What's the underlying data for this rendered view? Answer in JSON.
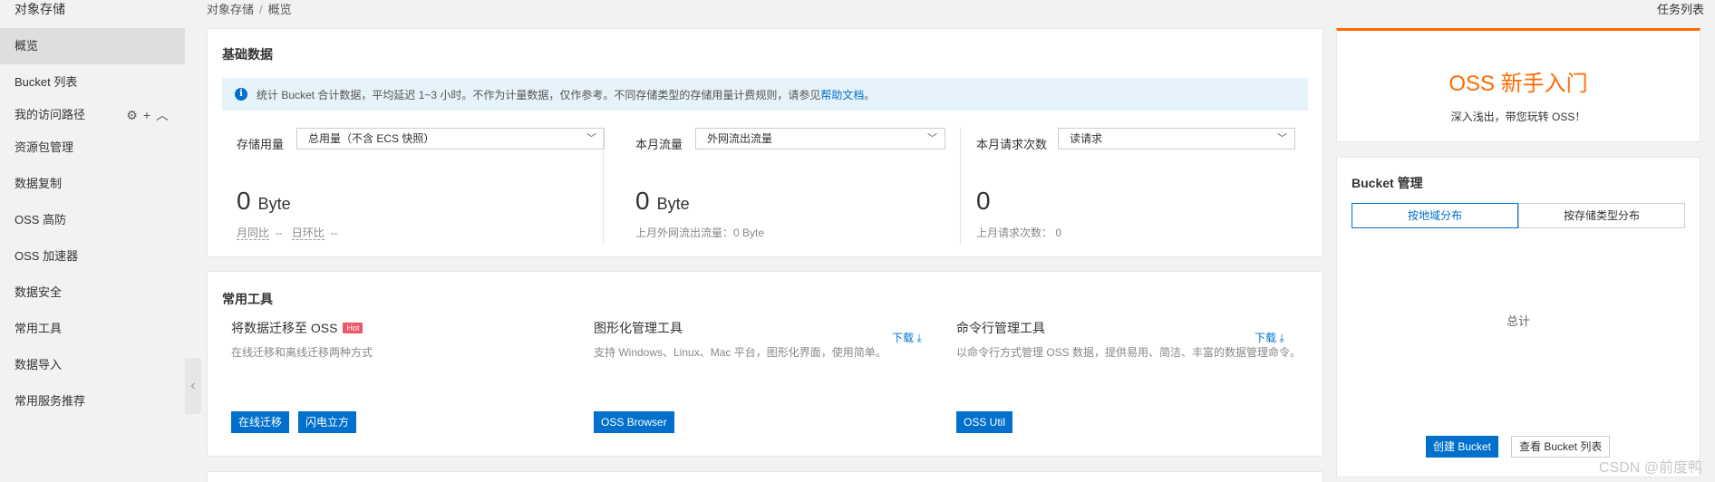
{
  "sidebar": {
    "title": "对象存储",
    "items": [
      {
        "label": "概览"
      },
      {
        "label": "Bucket 列表"
      },
      {
        "label": "资源包管理"
      },
      {
        "label": "数据复制"
      },
      {
        "label": "OSS 高防"
      },
      {
        "label": "OSS 加速器"
      },
      {
        "label": "数据安全"
      },
      {
        "label": "常用工具"
      },
      {
        "label": "数据导入"
      },
      {
        "label": "常用服务推荐"
      }
    ],
    "access_path": {
      "label": "我的访问路径",
      "icons": [
        "gear-icon",
        "plus-icon",
        "chevron-up-icon"
      ]
    }
  },
  "breadcrumb": [
    "对象存储",
    "概览"
  ],
  "task_list": "任务列表",
  "basic_data": {
    "title": "基础数据",
    "notice": {
      "text": "统计 Bucket 合计数据，平均延迟 1~3 小时。不作为计量数据，仅作参考。不同存储类型的存储用量计费规则，请参见",
      "link": "帮助文档",
      "end": "。"
    },
    "stats": [
      {
        "label": "存储用量",
        "select": "总用量（不含 ECS 快照）",
        "value": "0",
        "unit": "Byte",
        "sub_a": "月同比",
        "sub_a_val": "--",
        "sub_b": "日环比",
        "sub_b_val": "--"
      },
      {
        "label": "本月流量",
        "select": "外网流出流量",
        "value": "0",
        "unit": "Byte",
        "sub": "上月外网流出流量：0 Byte"
      },
      {
        "label": "本月请求次数",
        "select": "读请求",
        "value": "0",
        "unit": "",
        "sub": "上月请求次数：  0"
      }
    ]
  },
  "tools": {
    "title": "常用工具",
    "items": [
      {
        "title": "将数据迁移至 OSS",
        "badge": "Hot",
        "desc": "在线迁移和离线迁移两种方式",
        "buttons": [
          "在线迁移",
          "闪电立方"
        ]
      },
      {
        "title": "图形化管理工具",
        "download": "下载",
        "desc": "支持 Windows、Linux、Mac 平台，图形化界面，使用简单。",
        "buttons": [
          "OSS Browser"
        ]
      },
      {
        "title": "命令行管理工具",
        "download": "下载",
        "desc": "以命令行方式管理 OSS 数据，提供易用、简洁、丰富的数据管理命令。",
        "buttons": [
          "OSS Util"
        ]
      }
    ]
  },
  "oss_intro": {
    "title": "OSS 新手入门",
    "subtitle": "深入浅出，带您玩转 OSS！"
  },
  "bucket_mgmt": {
    "title": "Bucket 管理",
    "tabs": [
      "按地域分布",
      "按存储类型分布"
    ],
    "active_tab": 0,
    "total_label": "总计",
    "create_button": "创建 Bucket",
    "view_button": "查看 Bucket 列表"
  },
  "watermark": "CSDN @前度鸭",
  "colors": {
    "accent": "#0070cc",
    "orange": "#ff6a00",
    "hot": "#f05667"
  }
}
